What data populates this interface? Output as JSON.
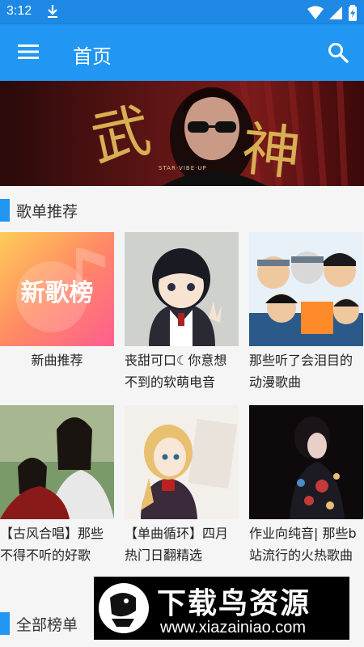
{
  "status_bar": {
    "time": "3:12"
  },
  "app_bar": {
    "title": "首页"
  },
  "banner": {
    "text_1": "武",
    "text_2": "神",
    "small_caption": "STAR·VIBE·UP"
  },
  "section_playlist": {
    "title": "歌单推荐"
  },
  "playlists": [
    {
      "label": "新曲推荐",
      "thumb_text": "新歌榜"
    },
    {
      "label": "丧甜可口☾你意想不到的软萌电音"
    },
    {
      "label": "那些听了会泪目的动漫歌曲"
    },
    {
      "label": "【古风合唱】那些不得不听的好歌"
    },
    {
      "label": "【单曲循环】四月热门日翻精选"
    },
    {
      "label": "作业向纯音| 那些b站流行的火热歌曲"
    }
  ],
  "section_ranking": {
    "title": "全部榜单"
  },
  "watermark": {
    "brand": "下载鸟资源",
    "url": "www.xiazainiao.com"
  },
  "colors": {
    "primary": "#2196f3",
    "status": "#1e88e5"
  }
}
